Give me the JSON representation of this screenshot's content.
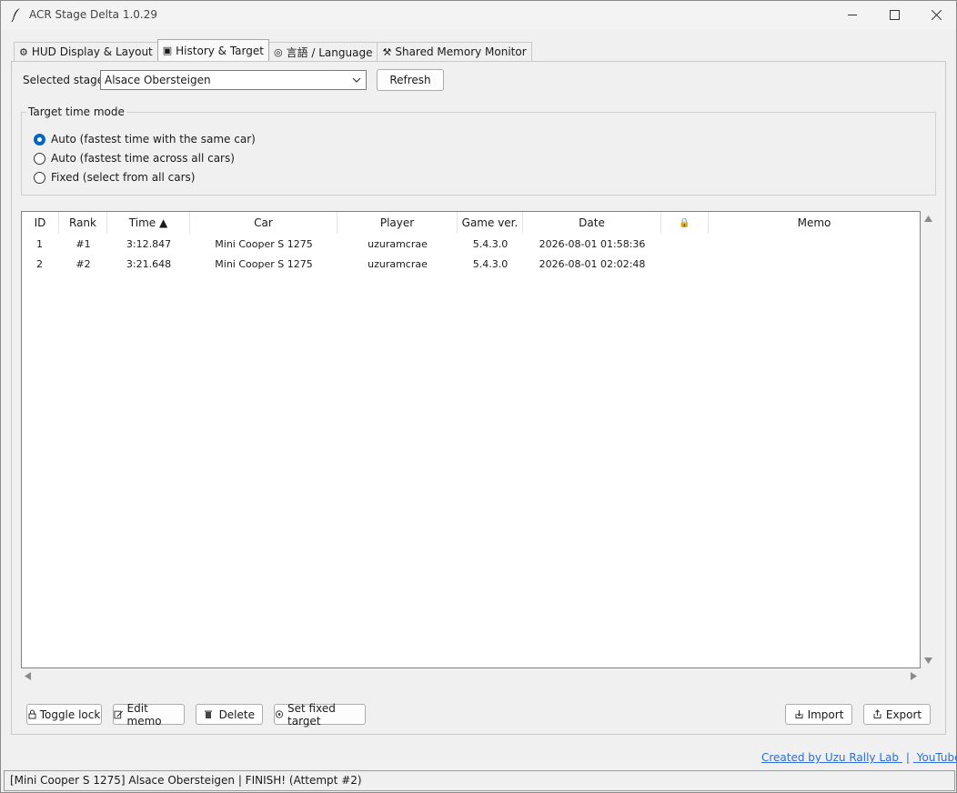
{
  "window": {
    "title": "ACR Stage Delta 1.0.29"
  },
  "tabs": [
    {
      "label": "HUD Display & Layout",
      "icon": "gear-icon",
      "glyph": "⚙"
    },
    {
      "label": "History & Target",
      "icon": "save-icon",
      "glyph": "▣"
    },
    {
      "label": "言語 / Language",
      "icon": "globe-icon",
      "glyph": "◎"
    },
    {
      "label": "Shared Memory Monitor",
      "icon": "wrench-icon",
      "glyph": "⚒"
    }
  ],
  "stage": {
    "label": "Selected stage:",
    "value": "Alsace Obersteigen",
    "refresh_label": "Refresh"
  },
  "target_mode": {
    "title": "Target time mode",
    "options": [
      {
        "label": "Auto (fastest time with the same car)",
        "selected": true
      },
      {
        "label": "Auto (fastest time across all cars)",
        "selected": false
      },
      {
        "label": "Fixed (select from all cars)",
        "selected": false
      }
    ]
  },
  "table": {
    "columns": [
      "ID",
      "Rank",
      "Time ▲",
      "Car",
      "Player",
      "Game ver.",
      "Date",
      "🔒",
      "Memo"
    ],
    "rows": [
      {
        "id": "1",
        "rank": "#1",
        "time": "3:12.847",
        "car": "Mini Cooper S 1275",
        "player": "uzuramcrae",
        "game_ver": "5.4.3.0",
        "date": "2026-08-01 01:58:36",
        "lock": "",
        "memo": ""
      },
      {
        "id": "2",
        "rank": "#2",
        "time": "3:21.648",
        "car": "Mini Cooper S 1275",
        "player": "uzuramcrae",
        "game_ver": "5.4.3.0",
        "date": "2026-08-01 02:02:48",
        "lock": "",
        "memo": ""
      }
    ]
  },
  "actions": {
    "toggle_lock": "Toggle lock",
    "edit_memo": "Edit memo",
    "delete": "Delete",
    "set_fixed_target": "Set fixed target",
    "import": "Import",
    "export": "Export"
  },
  "credits": {
    "created_by": "Created by Uzu Rally Lab",
    "separator": "|",
    "youtube": "YouTube"
  },
  "status": {
    "text": "[Mini Cooper S 1275] Alsace Obersteigen | FINISH! (Attempt #2)"
  },
  "colors": {
    "accent": "#0067c0",
    "link": "#2f6fd6"
  }
}
